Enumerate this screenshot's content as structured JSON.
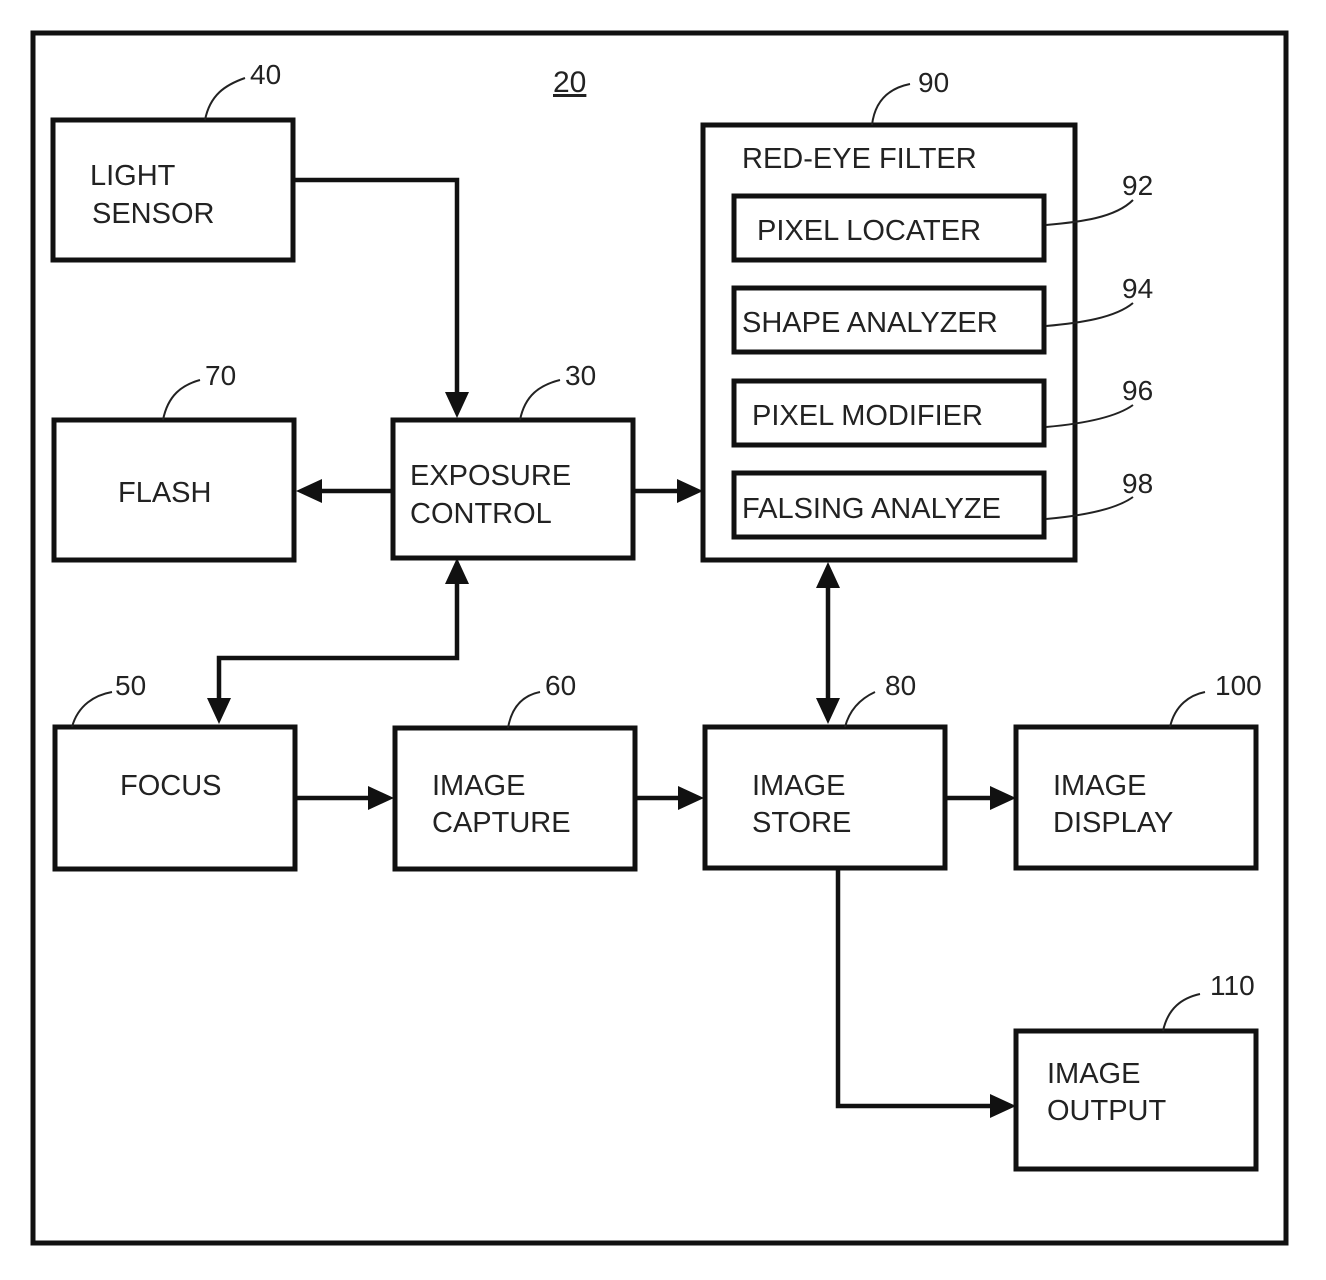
{
  "figure": {
    "ref": "20",
    "blocks": {
      "light_sensor": {
        "ref": "40",
        "lines": [
          "LIGHT",
          "SENSOR"
        ]
      },
      "flash": {
        "ref": "70",
        "lines": [
          "FLASH"
        ]
      },
      "exposure_control": {
        "ref": "30",
        "lines": [
          "EXPOSURE",
          "CONTROL"
        ]
      },
      "red_eye_filter": {
        "ref": "90",
        "title": "RED-EYE FILTER",
        "modules": [
          {
            "ref": "92",
            "label": "PIXEL LOCATER"
          },
          {
            "ref": "94",
            "label": "SHAPE ANALYZER"
          },
          {
            "ref": "96",
            "label": "PIXEL MODIFIER"
          },
          {
            "ref": "98",
            "label": "FALSING ANALYZE"
          }
        ]
      },
      "focus": {
        "ref": "50",
        "lines": [
          "FOCUS"
        ]
      },
      "image_capture": {
        "ref": "60",
        "lines": [
          "IMAGE",
          "CAPTURE"
        ]
      },
      "image_store": {
        "ref": "80",
        "lines": [
          "IMAGE",
          "STORE"
        ]
      },
      "image_display": {
        "ref": "100",
        "lines": [
          "IMAGE",
          "DISPLAY"
        ]
      },
      "image_output": {
        "ref": "110",
        "lines": [
          "IMAGE",
          "OUTPUT"
        ]
      }
    },
    "connections": [
      {
        "from": "LIGHT SENSOR",
        "to": "EXPOSURE CONTROL",
        "direction": "one-way"
      },
      {
        "from": "EXPOSURE CONTROL",
        "to": "FLASH",
        "direction": "one-way"
      },
      {
        "from": "EXPOSURE CONTROL",
        "to": "RED-EYE FILTER",
        "direction": "one-way"
      },
      {
        "from": "EXPOSURE CONTROL",
        "to": "FOCUS",
        "direction": "two-way"
      },
      {
        "from": "RED-EYE FILTER",
        "to": "IMAGE STORE",
        "direction": "two-way"
      },
      {
        "from": "FOCUS",
        "to": "IMAGE CAPTURE",
        "direction": "one-way"
      },
      {
        "from": "IMAGE CAPTURE",
        "to": "IMAGE STORE",
        "direction": "one-way"
      },
      {
        "from": "IMAGE STORE",
        "to": "IMAGE DISPLAY",
        "direction": "one-way"
      },
      {
        "from": "IMAGE STORE",
        "to": "IMAGE OUTPUT",
        "direction": "one-way"
      }
    ]
  }
}
